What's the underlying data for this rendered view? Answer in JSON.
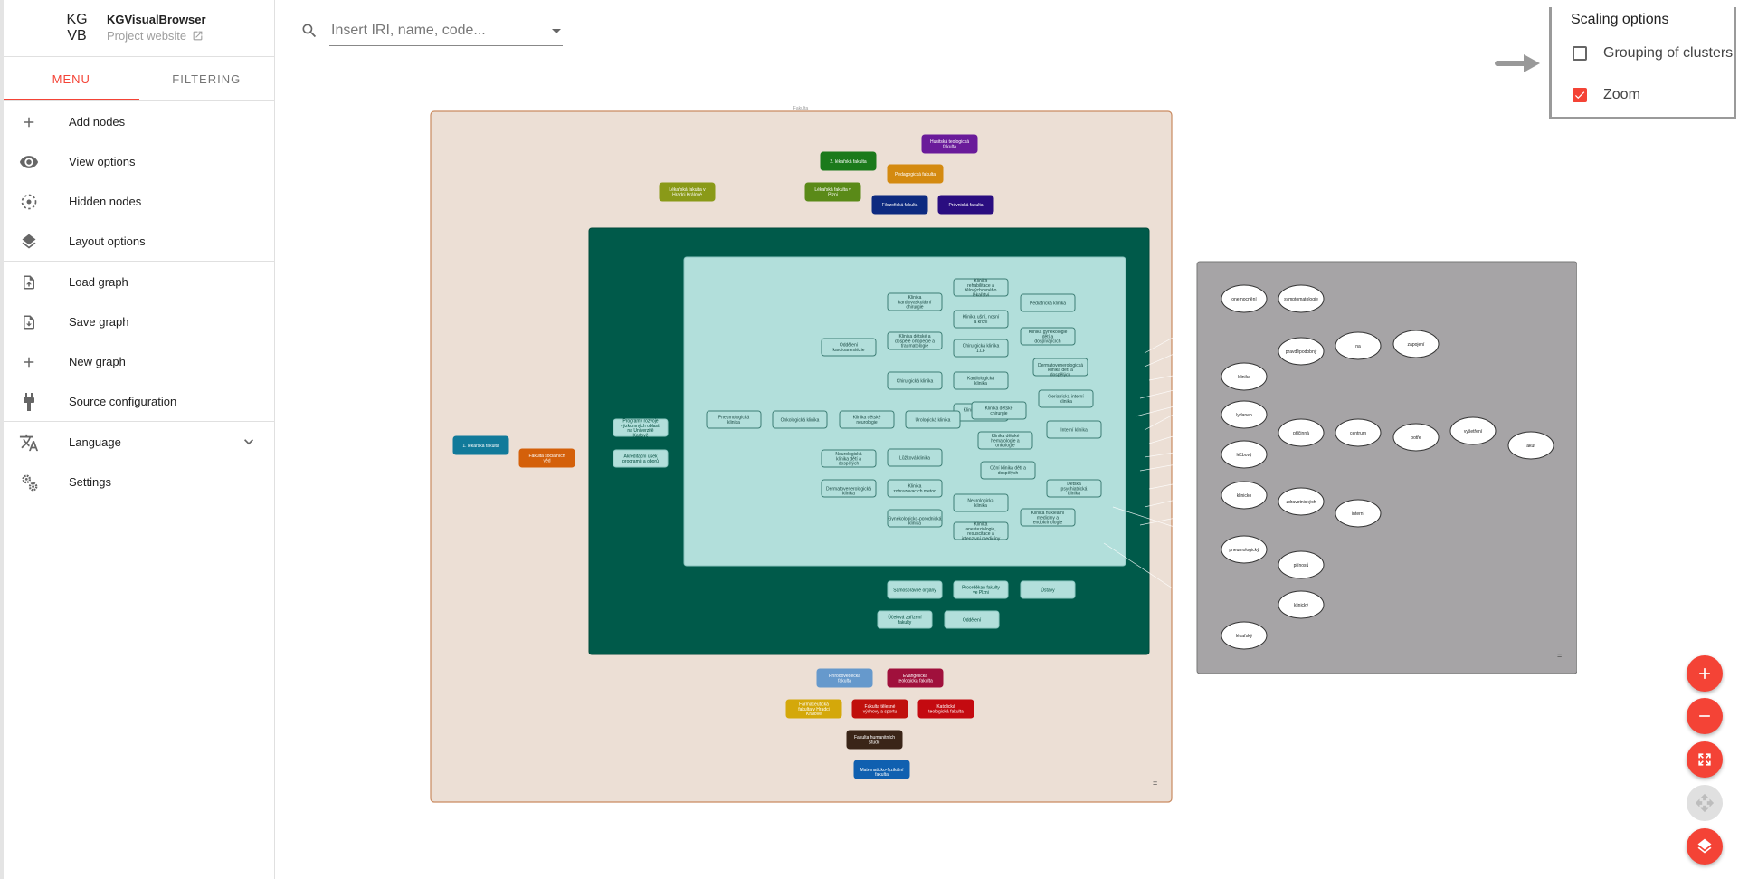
{
  "app": {
    "logo_line1": "KG",
    "logo_line2": "VB",
    "name": "KGVisualBrowser",
    "project_link": "Project website"
  },
  "tabs": [
    {
      "label": "MENU",
      "active": true
    },
    {
      "label": "FILTERING",
      "active": false
    }
  ],
  "menu": {
    "group1": [
      {
        "label": "Add nodes",
        "icon": "plus-icon"
      },
      {
        "label": "View options",
        "icon": "eye-icon"
      },
      {
        "label": "Hidden nodes",
        "icon": "dashed-circle-icon"
      },
      {
        "label": "Layout options",
        "icon": "layers-icon"
      }
    ],
    "group2": [
      {
        "label": "Load graph",
        "icon": "file-upload-icon"
      },
      {
        "label": "Save graph",
        "icon": "file-download-icon"
      },
      {
        "label": "New graph",
        "icon": "plus-icon"
      },
      {
        "label": "Source configuration",
        "icon": "plug-icon"
      }
    ],
    "group3": [
      {
        "label": "Language",
        "icon": "translate-icon"
      },
      {
        "label": "Settings",
        "icon": "gears-icon"
      }
    ]
  },
  "search": {
    "placeholder": "Insert IRI, name, code..."
  },
  "scaling": {
    "title": "Scaling options",
    "grouping_label": "Grouping of clusters",
    "grouping_checked": false,
    "zoom_label": "Zoom",
    "zoom_checked": true
  },
  "colors": {
    "accent": "#f44336",
    "cluster_bg": "#ecdfd5",
    "inner_cluster": "#005a4a",
    "innermost_cluster": "#b2dfdb",
    "grey_cluster": "#a6a4a6"
  },
  "graph": {
    "outer_label": "Fakulta",
    "top_nodes": [
      {
        "label": "Husitská teologická fakulta",
        "color": "#6a1b9a"
      },
      {
        "label": "2. lékařská fakulta",
        "color": "#1b7a1b"
      },
      {
        "label": "Pedagogická fakulta",
        "color": "#d48a10"
      },
      {
        "label": "Lékařská fakulta v Hradci Králové",
        "color": "#8a9a18"
      },
      {
        "label": "Lékařská fakulta v Plzni",
        "color": "#5a8a18"
      },
      {
        "label": "Filozofická fakulta",
        "color": "#0d2a80"
      },
      {
        "label": "Právnická fakulta",
        "color": "#2a0d80"
      }
    ],
    "left_nodes": [
      {
        "label": "1. lékařská fakulta",
        "color": "#117a9a"
      },
      {
        "label": "Fakulta sociálních věd",
        "color": "#d4600a"
      }
    ],
    "dark_green_nodes": [
      "Programy rozvoje výzkumných oblastí na Univerzitě Karlově",
      "Akreditační úsek programů a oborů",
      "Samosprávné orgány",
      "Proorděkan fakulty ve Plzni",
      "Ústavy",
      "Účelová zařízení fakulty",
      "Oddělení"
    ],
    "clinic_nodes": [
      "Klinika kardiovaskulární chirurgie",
      "Klinika rehabilitace a tělovýchovného lékařství",
      "Pediatrická klinika",
      "Klinika ušní, nosní a krční",
      "Oddělení kardioanestézie",
      "Klinika dětské a dospělé ortopedie a traumatologie",
      "Chirurgická klinika 1.LF",
      "Klinika gynekologie dětí a dospívajících",
      "Dermatovenerologická klinika dětí a dospělých",
      "Chirurgická klinika",
      "Kardiologická klinika",
      "Klinika infekčních nemocí",
      "Geriatrická interní klinika",
      "Pneumologická klinika",
      "Onkologická klinika",
      "Klinika dětské neurologie",
      "Urologická klinika",
      "Klinika dětské chirurgie",
      "Interní klinika",
      "Klinika dětské hematologie a onkologie",
      "Neurologická klinika dětí a dospělých",
      "Lůžková klinika",
      "Oční klinika dětí a dospělých",
      "Dermatovenerologická klinika",
      "Klinika zobrazovacích metod",
      "Dětská psychiatrická klinika",
      "Neurologická klinika",
      "Gynekologicko-porodnická klinika",
      "Klinika anesteziologie, resuscitace a intenzivní medicíny",
      "Klinika nukleární medicíny a endokrinologie"
    ],
    "bottom_nodes": [
      {
        "label": "Přírodovědecká fakulta",
        "color": "#6699cc"
      },
      {
        "label": "Evangelická teologická fakulta",
        "color": "#a0103c"
      },
      {
        "label": "Farmaceutická fakulta v Hradci Králové",
        "color": "#d4a80a"
      },
      {
        "label": "Fakulta tělesné výchovy a sportu",
        "color": "#c0100c"
      },
      {
        "label": "Katolická teologická fakulta",
        "color": "#c40a10"
      },
      {
        "label": "Fakulta humanitních studií",
        "color": "#3a2518"
      },
      {
        "label": "Matematicko-fyzikální fakulta",
        "color": "#1060b0"
      }
    ],
    "word_nodes": [
      "onemocnění",
      "symptomatologie",
      "pravděpodobný",
      "na",
      "zapojení",
      "klinika",
      "lydaneo",
      "příčinná",
      "centrum",
      "potře",
      "vyšetření",
      "akut",
      "léčbový",
      "klinicko",
      "zdravotnických",
      "interní",
      "pneumologický",
      "přínosů",
      "klinický",
      "lékařský"
    ],
    "corner_marks": [
      "=",
      "="
    ]
  },
  "fabs": [
    {
      "name": "zoom-in-button",
      "icon": "plus-icon"
    },
    {
      "name": "zoom-out-button",
      "icon": "minus-icon"
    },
    {
      "name": "fit-screen-button",
      "icon": "expand-icon"
    },
    {
      "name": "center-button",
      "icon": "move-icon"
    },
    {
      "name": "layers-button",
      "icon": "layers-icon"
    }
  ]
}
